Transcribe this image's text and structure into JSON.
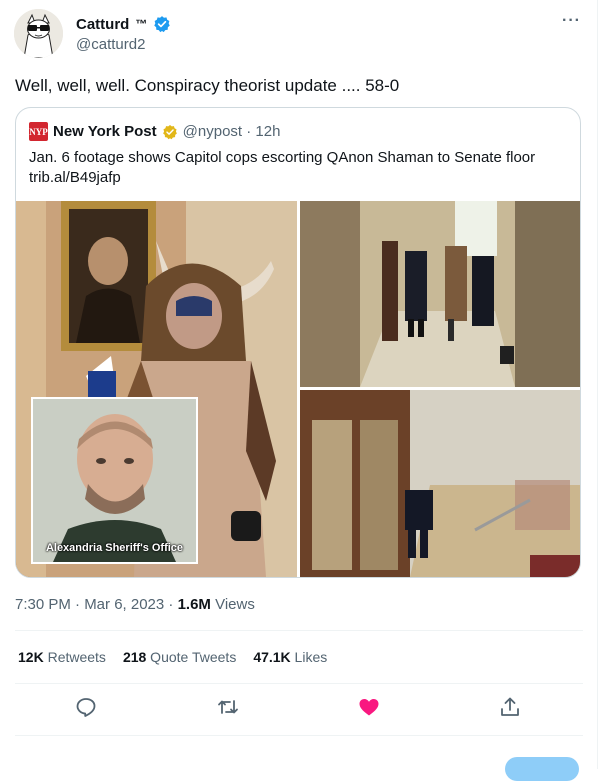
{
  "author": {
    "name": "Catturd",
    "tm": "™",
    "handle": "@catturd2"
  },
  "tweet_text": "Well, well, well.  Conspiracy theorist update .... 58-0",
  "quote": {
    "name": "New York Post",
    "handle_time": "@nypost · 12h",
    "logo_text": "NYP",
    "text": "Jan. 6 footage shows Capitol cops escorting QAnon Shaman to Senate floor",
    "link": "trib.al/B49jafp",
    "mugshot_caption": "Alexandria Sheriff's Office"
  },
  "meta": {
    "time_date": "7:30 PM · Mar 6, 2023 · ",
    "views_count": "1.6M",
    "views_label": " Views"
  },
  "stats": [
    {
      "count": "12K",
      "label": " Retweets"
    },
    {
      "count": "218",
      "label": " Quote Tweets"
    },
    {
      "count": "47.1K",
      "label": " Likes"
    }
  ],
  "actions": [
    "reply-icon",
    "retweet-icon",
    "like-icon",
    "share-icon"
  ],
  "colors": {
    "verified_blue": "#1d9bf0",
    "gold_badge": "#e2b719",
    "like_pink": "#f91880",
    "secondary_text": "#536471"
  },
  "more_glyph": "···"
}
